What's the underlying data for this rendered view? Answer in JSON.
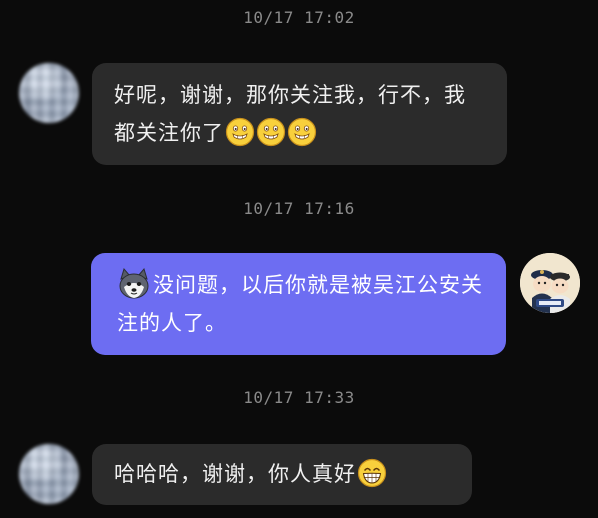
{
  "messages": [
    {
      "timestamp": "10/17 17:02",
      "sender": "other",
      "avatar_icon": "blurred-user-avatar",
      "text": "好呢，谢谢，那你关注我，行不，我都关注你了",
      "emojis": [
        "grinning-face-emoji",
        "grinning-face-emoji",
        "grinning-face-emoji"
      ]
    },
    {
      "timestamp": "10/17 17:16",
      "sender": "self",
      "avatar_icon": "police-cartoon-avatar",
      "leading_icon": "husky-dog-emoji",
      "text": "没问题，以后你就是被吴江公安关注的人了。"
    },
    {
      "timestamp": "10/17 17:33",
      "sender": "other",
      "avatar_icon": "blurred-user-avatar",
      "text": "哈哈哈，谢谢，你人真好",
      "emojis": [
        "big-grin-emoji"
      ]
    }
  ],
  "colors": {
    "background": "#0b0b0b",
    "incoming_bubble": "#2b2b2b",
    "outgoing_bubble": "#6d6df2",
    "timestamp": "#8a8a8a"
  }
}
